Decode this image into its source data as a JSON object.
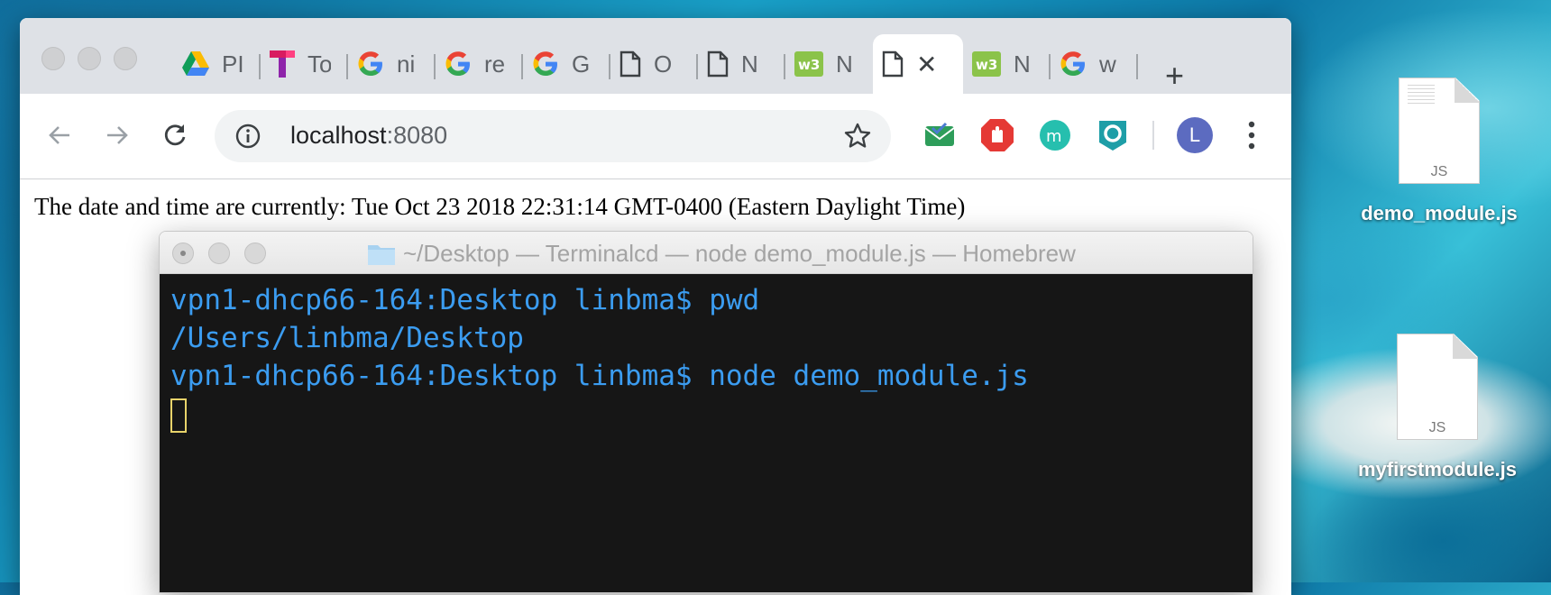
{
  "browser": {
    "tabs": [
      {
        "title": "PI",
        "icon": "google-drive-icon"
      },
      {
        "title": "To",
        "icon": "t-logo-icon"
      },
      {
        "title": "ni",
        "icon": "google-icon"
      },
      {
        "title": "re",
        "icon": "google-icon"
      },
      {
        "title": "G",
        "icon": "google-icon"
      },
      {
        "title": "O",
        "icon": "document-icon"
      },
      {
        "title": "N",
        "icon": "document-icon"
      },
      {
        "title": "N",
        "icon": "w3schools-icon"
      },
      {
        "title": "",
        "icon": "document-icon",
        "active": true
      },
      {
        "title": "N",
        "icon": "w3schools-icon"
      },
      {
        "title": "w",
        "icon": "google-icon"
      }
    ],
    "new_tab_label": "+",
    "active_tab_close": "✕",
    "address": {
      "host": "localhost",
      "port": ":8080"
    },
    "page_text": "The date and time are currently: Tue Oct 23 2018 22:31:14 GMT-0400 (Eastern Daylight Time)",
    "profile_initial": "L",
    "colors": {
      "accent": "#1a73e8",
      "tab_strip": "#dee1e6",
      "avatar": "#5c6bc0"
    }
  },
  "terminal": {
    "title": "~/Desktop — Terminalcd  — node demo_module.js — Homebrew",
    "lines": [
      "vpn1-dhcp66-164:Desktop linbma$ pwd",
      "/Users/linbma/Desktop",
      "vpn1-dhcp66-164:Desktop linbma$ node demo_module.js"
    ],
    "text_color": "#3b9cf0"
  },
  "desktop": {
    "icons": [
      {
        "name": "demo_module.js",
        "ext": "JS"
      },
      {
        "name": "myfirstmodule.js",
        "ext": "JS"
      }
    ]
  }
}
